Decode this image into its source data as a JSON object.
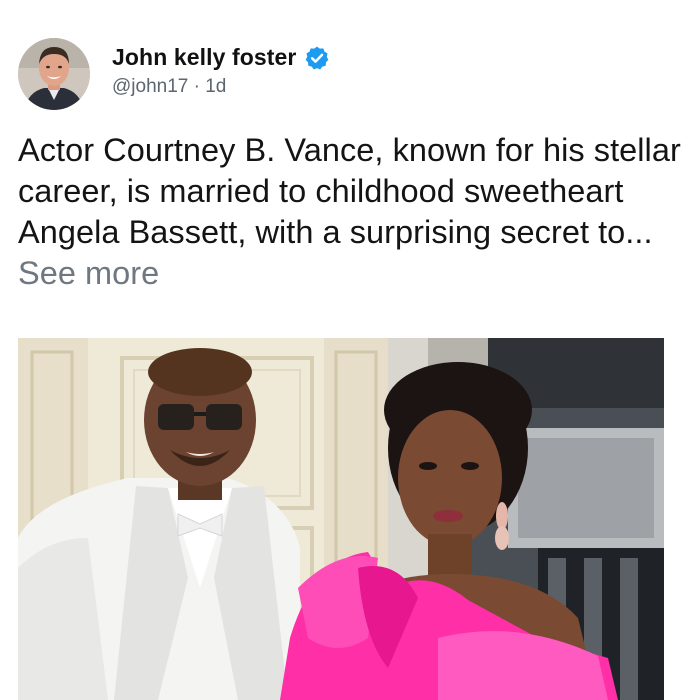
{
  "post": {
    "author_name": "John kelly foster",
    "handle": "@john17",
    "separator": "·",
    "time_ago": "1d",
    "text": "Actor Courtney B. Vance, known for his stellar career, is married to childhood sweetheart Angela Bassett, with a surprising secret to...",
    "see_more": "See more",
    "verified": true,
    "icons": {
      "verified": "verified-badge-icon"
    },
    "colors": {
      "verified_badge": "#1d9bf0",
      "muted_text": "#5b6670",
      "see_more": "#6f7880",
      "dress_pink": "#ff2fa8"
    }
  }
}
